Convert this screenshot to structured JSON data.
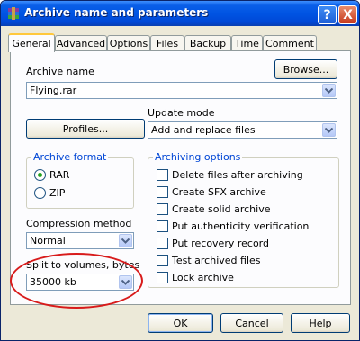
{
  "window": {
    "title": "Archive name and parameters",
    "help_label": "?",
    "close_label": "X"
  },
  "tabs": [
    {
      "label": "General",
      "active": true
    },
    {
      "label": "Advanced"
    },
    {
      "label": "Options"
    },
    {
      "label": "Files"
    },
    {
      "label": "Backup"
    },
    {
      "label": "Time"
    },
    {
      "label": "Comment"
    }
  ],
  "general": {
    "archive_name_label": "Archive name",
    "archive_name_value": "Flying.rar",
    "browse_label": "Browse...",
    "profiles_label": "Profiles...",
    "update_mode_label": "Update mode",
    "update_mode_value": "Add and replace files",
    "archive_format": {
      "title": "Archive format",
      "options": [
        {
          "label": "RAR",
          "selected": true
        },
        {
          "label": "ZIP",
          "selected": false
        }
      ]
    },
    "compression_method_label": "Compression method",
    "compression_method_value": "Normal",
    "split_label": "Split to volumes, bytes",
    "split_value": "35000 kb",
    "archiving_options": {
      "title": "Archiving options",
      "items": [
        {
          "label": "Delete files after archiving",
          "checked": false
        },
        {
          "label": "Create SFX archive",
          "checked": false
        },
        {
          "label": "Create solid archive",
          "checked": false
        },
        {
          "label": "Put authenticity verification",
          "checked": false
        },
        {
          "label": "Put recovery record",
          "checked": false
        },
        {
          "label": "Test archived files",
          "checked": false
        },
        {
          "label": "Lock archive",
          "checked": false
        }
      ]
    }
  },
  "footer": {
    "ok_label": "OK",
    "cancel_label": "Cancel",
    "help_label": "Help"
  },
  "colors": {
    "titlebar": "#0054e3",
    "group_title": "#0046d5",
    "annotation": "#d81b1b"
  }
}
